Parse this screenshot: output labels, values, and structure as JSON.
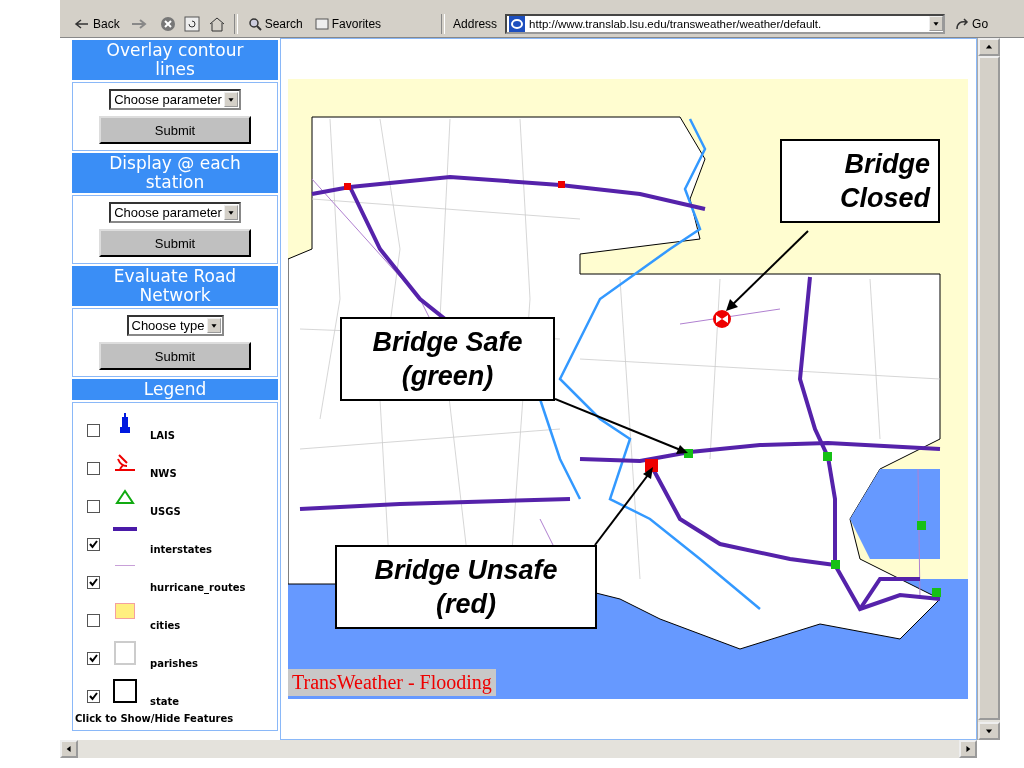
{
  "toolbar": {
    "back": "Back",
    "search": "Search",
    "favorites": "Favorites",
    "address_label": "Address",
    "url": "http://www.translab.lsu.edu/transweather/weather/default.",
    "go": "Go"
  },
  "panels": [
    {
      "title": "Overlay contour lines",
      "select": "Choose parameter",
      "button": "Submit"
    },
    {
      "title": "Display @ each station",
      "select": "Choose parameter",
      "button": "Submit"
    },
    {
      "title": "Evaluate Road Network",
      "select": "Choose type",
      "button": "Submit"
    }
  ],
  "legend": {
    "title": "Legend",
    "items": [
      {
        "label": "LAIS",
        "kind": "tower",
        "checked": false
      },
      {
        "label": "NWS",
        "kind": "dish",
        "checked": false
      },
      {
        "label": "USGS",
        "kind": "triangle",
        "checked": false
      },
      {
        "label": "interstates",
        "kind": "thick-line",
        "checked": true
      },
      {
        "label": "hurricane_routes",
        "kind": "thin-line",
        "checked": true
      },
      {
        "label": "cities",
        "kind": "yellow-area",
        "checked": false
      },
      {
        "label": "parishes",
        "kind": "grey-outline",
        "checked": true
      },
      {
        "label": "state",
        "kind": "black-outline",
        "checked": true
      }
    ],
    "footer": "Click to Show/Hide Features"
  },
  "map": {
    "callouts": [
      {
        "kind": "closed",
        "lines": [
          "Bridge",
          "Closed"
        ]
      },
      {
        "kind": "safe",
        "lines": [
          "Bridge Safe",
          "(green)"
        ]
      },
      {
        "kind": "unsafe",
        "lines": [
          "Bridge Unsafe",
          "(red)"
        ]
      }
    ],
    "caption": "TransWeather - Flooding"
  }
}
